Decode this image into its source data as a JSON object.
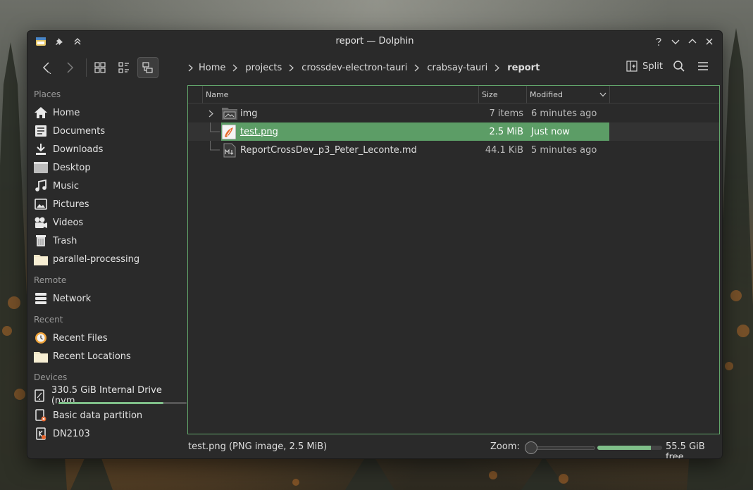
{
  "window": {
    "title": "report — Dolphin"
  },
  "breadcrumb": [
    {
      "label": "Home"
    },
    {
      "label": "projects"
    },
    {
      "label": "crossdev-electron-tauri"
    },
    {
      "label": "crabsay-tauri"
    },
    {
      "label": "report"
    }
  ],
  "toolbar": {
    "split_label": "Split"
  },
  "sidebar": {
    "places_title": "Places",
    "places": [
      {
        "label": "Home",
        "icon": "home-icon"
      },
      {
        "label": "Documents",
        "icon": "documents-icon"
      },
      {
        "label": "Downloads",
        "icon": "downloads-icon"
      },
      {
        "label": "Desktop",
        "icon": "desktop-icon"
      },
      {
        "label": "Music",
        "icon": "music-icon"
      },
      {
        "label": "Pictures",
        "icon": "pictures-icon"
      },
      {
        "label": "Videos",
        "icon": "videos-icon"
      },
      {
        "label": "Trash",
        "icon": "trash-icon"
      },
      {
        "label": "parallel-processing",
        "icon": "folder-icon"
      }
    ],
    "remote_title": "Remote",
    "remote": [
      {
        "label": "Network",
        "icon": "network-icon"
      }
    ],
    "recent_title": "Recent",
    "recent": [
      {
        "label": "Recent Files",
        "icon": "recent-files-icon"
      },
      {
        "label": "Recent Locations",
        "icon": "folder-icon"
      }
    ],
    "devices_title": "Devices",
    "devices": [
      {
        "label": "330.5 GiB Internal Drive (nvm...",
        "icon": "drive-icon",
        "usage_fraction": 0.82
      },
      {
        "label": "Basic data partition",
        "icon": "partition-icon"
      },
      {
        "label": "DN2103",
        "icon": "usb-drive-icon"
      }
    ]
  },
  "columns": {
    "name": "Name",
    "size": "Size",
    "modified": "Modified"
  },
  "files": [
    {
      "name": "img",
      "size": "7 items",
      "modified": "6 minutes ago",
      "icon": "folder-image-icon",
      "expandable": true,
      "selected": false
    },
    {
      "name": "test.png",
      "size": "2.5 MiB",
      "modified": "Just now",
      "icon": "image-file-icon",
      "expandable": false,
      "selected": true
    },
    {
      "name": "ReportCrossDev_p3_Peter_Leconte.md",
      "size": "44.1 KiB",
      "modified": "5 minutes ago",
      "icon": "markdown-file-icon",
      "expandable": false,
      "selected": false
    }
  ],
  "status": {
    "selection_text": "test.png (PNG image, 2.5 MiB)",
    "zoom_label": "Zoom:",
    "zoom_fraction": 0.05,
    "free_text": "55.5 GiB free",
    "free_used_fraction": 0.83
  },
  "colors": {
    "accent": "#5c9d66",
    "window_bg": "#2a2a2a"
  }
}
